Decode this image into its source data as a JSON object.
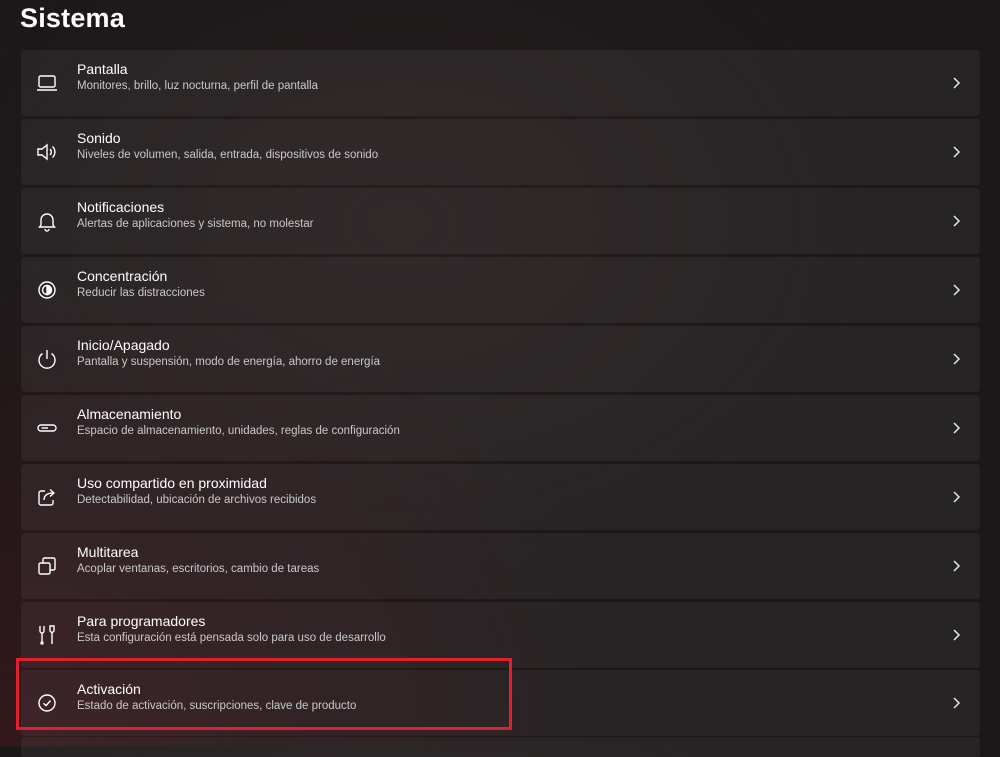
{
  "page": {
    "title": "Sistema"
  },
  "settings": [
    {
      "icon": "monitor-icon",
      "title": "Pantalla",
      "subtitle": "Monitores, brillo, luz nocturna, perfil de pantalla"
    },
    {
      "icon": "speaker-icon",
      "title": "Sonido",
      "subtitle": "Niveles de volumen, salida, entrada, dispositivos de sonido"
    },
    {
      "icon": "bell-icon",
      "title": "Notificaciones",
      "subtitle": "Alertas de aplicaciones y sistema, no molestar"
    },
    {
      "icon": "focus-icon",
      "title": "Concentración",
      "subtitle": "Reducir las distracciones"
    },
    {
      "icon": "power-icon",
      "title": "Inicio/Apagado",
      "subtitle": "Pantalla y suspensión, modo de energía, ahorro de energía"
    },
    {
      "icon": "storage-icon",
      "title": "Almacenamiento",
      "subtitle": "Espacio de almacenamiento, unidades, reglas de configuración"
    },
    {
      "icon": "share-icon",
      "title": "Uso compartido en proximidad",
      "subtitle": "Detectabilidad, ubicación de archivos recibidos"
    },
    {
      "icon": "multitask-icon",
      "title": "Multitarea",
      "subtitle": "Acoplar ventanas, escritorios, cambio de tareas"
    },
    {
      "icon": "developer-tools-icon",
      "title": "Para programadores",
      "subtitle": "Esta configuración está pensada solo para uso de desarrollo"
    },
    {
      "icon": "checkmark-circle-icon",
      "title": "Activación",
      "subtitle": "Estado de activación, suscripciones, clave de producto"
    }
  ],
  "colors": {
    "highlight": "#e0202e",
    "background": "#1b1819",
    "card": "#2a2627"
  }
}
